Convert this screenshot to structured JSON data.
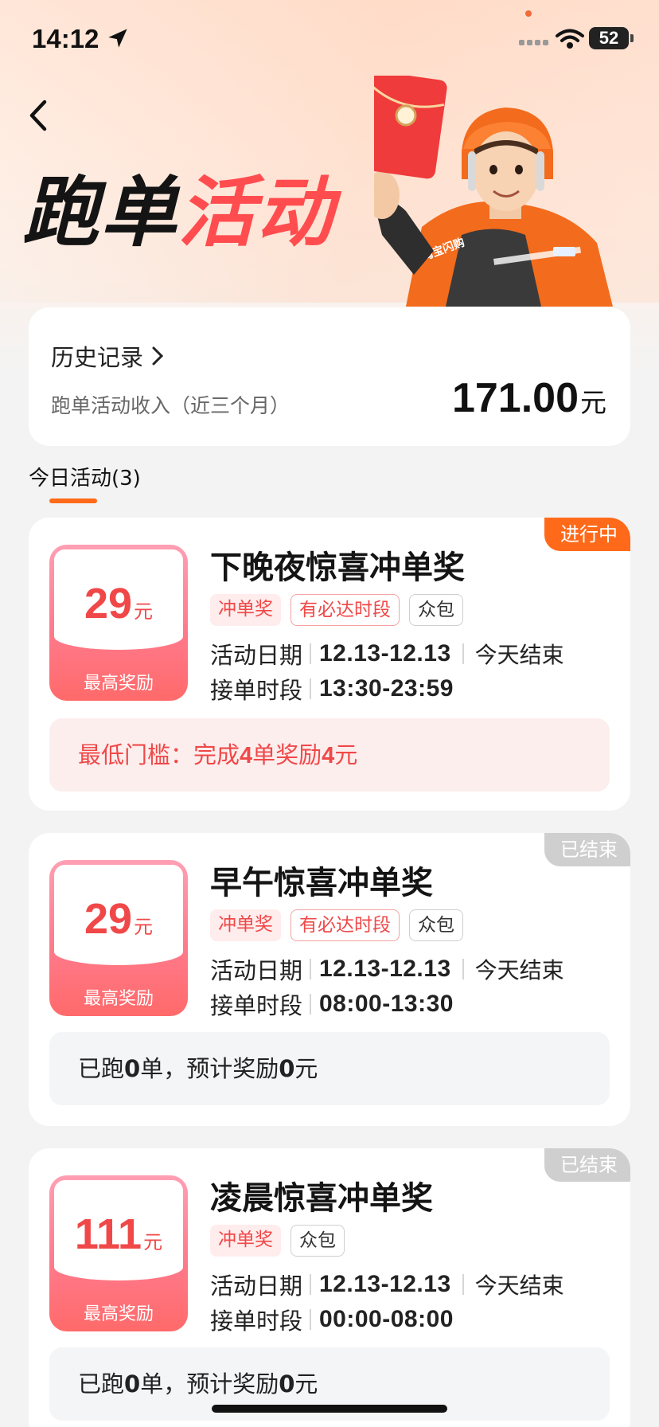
{
  "status_bar": {
    "time": "14:12",
    "battery": "52"
  },
  "header": {
    "title_part1": "跑单",
    "title_part2": "活动"
  },
  "summary": {
    "history_label": "历史记录",
    "income_label": "跑单活动收入（近三个月）",
    "income_value": "171.00",
    "income_unit": "元"
  },
  "tabs": {
    "today": "今日活动(3)"
  },
  "activities": [
    {
      "status": "进行中",
      "reward": "29",
      "reward_unit": "元",
      "reward_caption": "最高奖励",
      "title": "下晚夜惊喜冲单奖",
      "tags": [
        "冲单奖",
        "有必达时段",
        "众包"
      ],
      "date_label": "活动日期",
      "date": "12.13-12.13",
      "ends": "今天结束",
      "time_label": "接单时段",
      "time": "13:30-23:59",
      "note_prefix": "最低门槛：完成",
      "note_orders": "4",
      "note_mid": "单奖励",
      "note_amount": "4",
      "note_suffix": "元"
    },
    {
      "status": "已结束",
      "reward": "29",
      "reward_unit": "元",
      "reward_caption": "最高奖励",
      "title": "早午惊喜冲单奖",
      "tags": [
        "冲单奖",
        "有必达时段",
        "众包"
      ],
      "date_label": "活动日期",
      "date": "12.13-12.13",
      "ends": "今天结束",
      "time_label": "接单时段",
      "time": "08:00-13:30",
      "note_prefix": "已跑",
      "note_orders": "0",
      "note_mid": "单，预计奖励",
      "note_amount": "0",
      "note_suffix": "元"
    },
    {
      "status": "已结束",
      "reward": "111",
      "reward_unit": "元",
      "reward_caption": "最高奖励",
      "title": "凌晨惊喜冲单奖",
      "tags": [
        "冲单奖",
        "众包"
      ],
      "date_label": "活动日期",
      "date": "12.13-12.13",
      "ends": "今天结束",
      "time_label": "接单时段",
      "time": "00:00-08:00",
      "note_prefix": "已跑",
      "note_orders": "0",
      "note_mid": "单，预计奖励",
      "note_amount": "0",
      "note_suffix": "元"
    }
  ],
  "mascot": {
    "badge_text": "淘宝闪购"
  }
}
